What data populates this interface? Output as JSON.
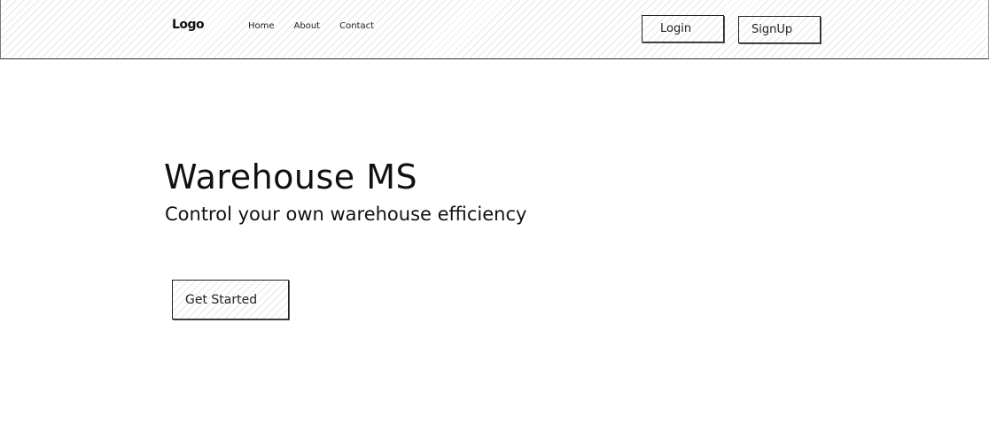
{
  "navbar": {
    "logo": "Logo",
    "links": [
      "Home",
      "About",
      "Contact"
    ],
    "login_label": "Login",
    "signup_label": "SignUp"
  },
  "hero": {
    "title": "Warehouse MS",
    "subtitle": "Control your own warehouse efficiency",
    "cta_label": "Get Started"
  }
}
